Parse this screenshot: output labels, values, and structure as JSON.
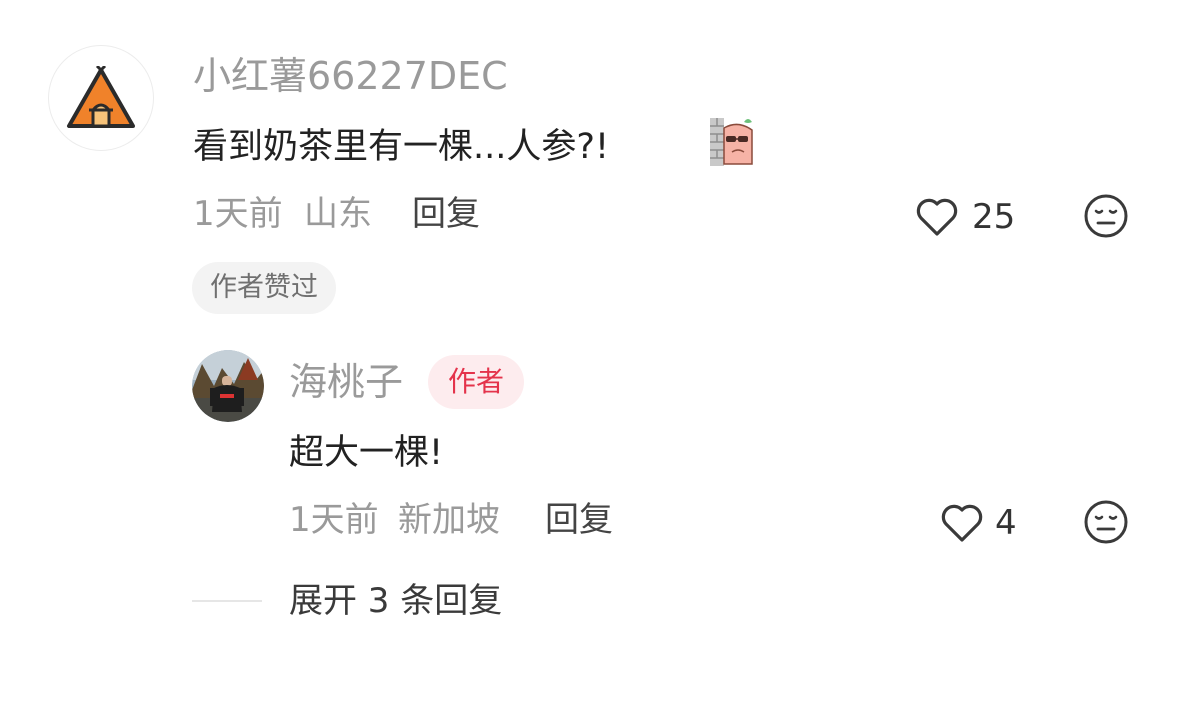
{
  "comment": {
    "username": "小红薯66227DEC",
    "text": "看到奶茶里有一棵...人参?!",
    "time": "1天前",
    "location": "山东",
    "reply_label": "回复",
    "like_count": "25",
    "liked_by_author": "作者赞过"
  },
  "reply": {
    "username": "海桃子",
    "author_badge": "作者",
    "text": "超大一棵!",
    "time": "1天前",
    "location": "新加坡",
    "reply_label": "回复",
    "like_count": "4"
  },
  "expand_label": "展开 3 条回复",
  "icons": {
    "main_avatar": "tent-avatar-icon",
    "emoji": "peeking-ginseng-sticker-icon",
    "like": "heart-outline-icon",
    "dislike": "meh-face-icon"
  },
  "colors": {
    "tent_orange": "#f0822a",
    "author_badge_text": "#e4334b",
    "author_badge_bg": "#fdecee"
  }
}
